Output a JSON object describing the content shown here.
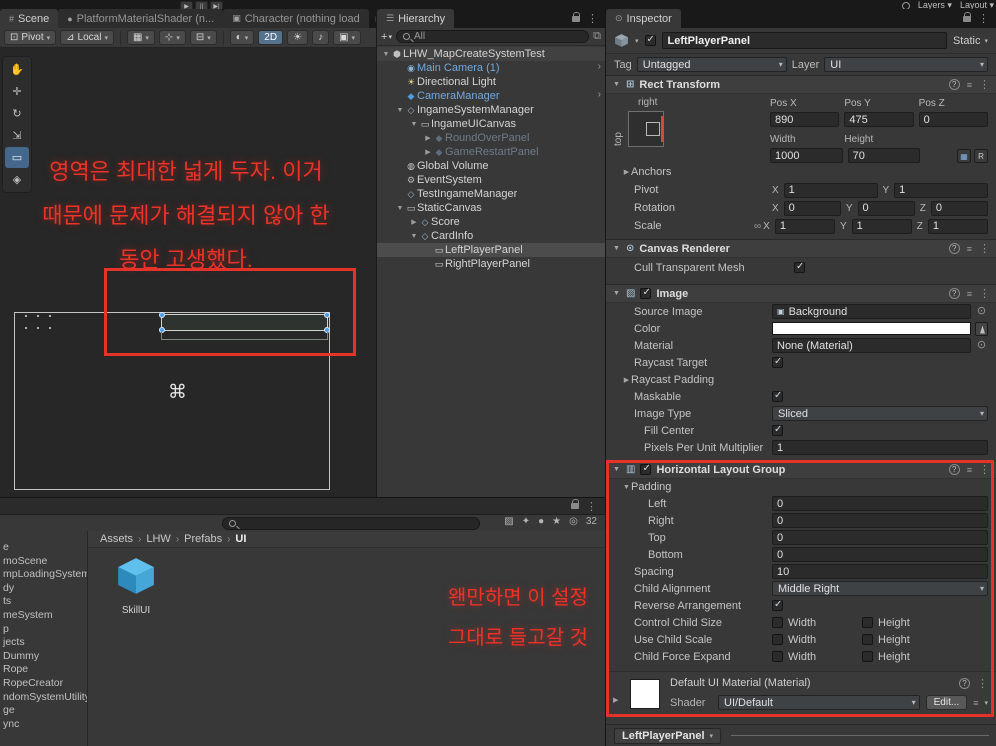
{
  "top_bar": {
    "layers_label": "Layers",
    "layout_label": "Layout"
  },
  "scene": {
    "tabs": [
      "Scene",
      "PlatformMaterialShader (n...",
      "Character (nothing load"
    ],
    "toolbar": {
      "pivot_label": "Pivot",
      "local_label": "Local",
      "mode_2d_label": "2D"
    },
    "annotation_lines": [
      "영역은 최대한 넓게 두자. 이거",
      "때문에 문제가 해결되지 않아 한",
      "동안 고생했다."
    ]
  },
  "hierarchy": {
    "tab_label": "Hierarchy",
    "search_value": "All",
    "items": [
      {
        "label": "LHW_MapCreateSystemTest"
      },
      {
        "label": "Main Camera (1)"
      },
      {
        "label": "Directional Light"
      },
      {
        "label": "CameraManager"
      },
      {
        "label": "IngameSystemManager"
      },
      {
        "label": "IngameUICanvas"
      },
      {
        "label": "RoundOverPanel"
      },
      {
        "label": "GameRestartPanel"
      },
      {
        "label": "Global Volume"
      },
      {
        "label": "EventSystem"
      },
      {
        "label": "TestIngameManager"
      },
      {
        "label": "StaticCanvas"
      },
      {
        "label": "Score"
      },
      {
        "label": "CardInfo"
      },
      {
        "label": "LeftPlayerPanel"
      },
      {
        "label": "RightPlayerPanel"
      }
    ]
  },
  "inspector": {
    "tab_label": "Inspector",
    "header": {
      "name": "LeftPlayerPanel",
      "static_label": "Static"
    },
    "tag_row": {
      "tag_label": "Tag",
      "tag_value": "Untagged",
      "layer_label": "Layer",
      "layer_value": "UI"
    },
    "rect_transform": {
      "title": "Rect Transform",
      "anchor_preset_top": "right",
      "anchor_preset_side": "top",
      "pos_labels": [
        "Pos X",
        "Pos Y",
        "Pos Z"
      ],
      "pos_values": [
        "890",
        "475",
        "0"
      ],
      "size_labels": [
        "Width",
        "Height"
      ],
      "size_values": [
        "1000",
        "70"
      ],
      "r_button": "R",
      "anchors_label": "Anchors",
      "pivot_label": "Pivot",
      "rotation_label": "Rotation",
      "scale_label": "Scale",
      "axis_x": "X",
      "axis_y": "Y",
      "axis_z": "Z",
      "pivot_x": "1",
      "pivot_y": "1",
      "rot_x": "0",
      "rot_y": "0",
      "rot_z": "0",
      "scale_x": "1",
      "scale_y": "1",
      "scale_z": "1"
    },
    "canvas_renderer": {
      "title": "Canvas Renderer",
      "cull_label": "Cull Transparent Mesh"
    },
    "image": {
      "title": "Image",
      "source_label": "Source Image",
      "source_value": "Background",
      "color_label": "Color",
      "material_label": "Material",
      "material_value": "None (Material)",
      "raycast_label": "Raycast Target",
      "raycast_padding_label": "Raycast Padding",
      "maskable_label": "Maskable",
      "image_type_label": "Image Type",
      "image_type_value": "Sliced",
      "fill_center_label": "Fill Center",
      "ppu_label": "Pixels Per Unit Multiplier",
      "ppu_value": "1"
    },
    "layout_group": {
      "title": "Horizontal Layout Group",
      "padding_label": "Padding",
      "left_label": "Left",
      "left_value": "0",
      "right_label": "Right",
      "right_value": "0",
      "top_label": "Top",
      "top_value": "0",
      "bottom_label": "Bottom",
      "bottom_value": "0",
      "spacing_label": "Spacing",
      "spacing_value": "10",
      "child_alignment_label": "Child Alignment",
      "child_alignment_value": "Middle Right",
      "reverse_label": "Reverse Arrangement",
      "control_label": "Control Child Size",
      "use_scale_label": "Use Child Scale",
      "force_expand_label": "Child Force Expand",
      "width_label": "Width",
      "height_label": "Height"
    },
    "material": {
      "title": "Default UI Material (Material)",
      "shader_label": "Shader",
      "shader_value": "UI/Default",
      "edit_label": "Edit..."
    },
    "footer_button": "LeftPlayerPanel"
  },
  "project": {
    "breadcrumb": [
      "Assets",
      "LHW",
      "Prefabs",
      "UI"
    ],
    "hidden_count": "32",
    "folders": [
      "e",
      "moScene",
      "mpLoadingSystem",
      "dy",
      "ts",
      "meSystem",
      "p",
      "jects",
      "Dummy",
      "Rope",
      "RopeCreator",
      "ndomSystemUtility",
      "ge",
      "ync"
    ],
    "asset_label": "SkillUI",
    "annotation_lines": [
      "왠만하면 이 설정",
      "그대로 들고갈 것"
    ]
  }
}
